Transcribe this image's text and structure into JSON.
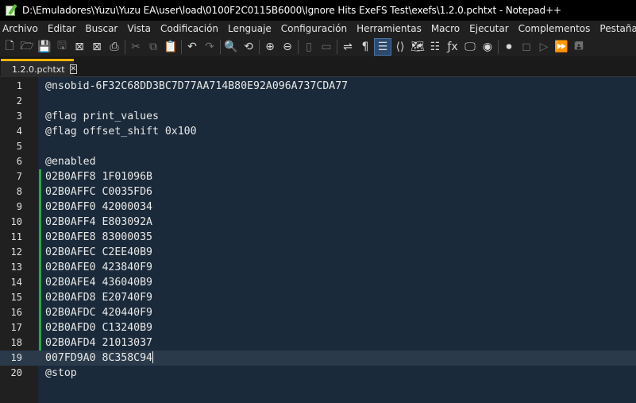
{
  "window": {
    "title": "D:\\Emuladores\\Yuzu\\Yuzu EA\\user\\load\\0100F2C0115B6000\\Ignore Hits ExeFS Test\\exefs\\1.2.0.pchtxt - Notepad++",
    "app_icon": "notepad-plus-plus-icon"
  },
  "menu": [
    "Archivo",
    "Editar",
    "Buscar",
    "Vista",
    "Codificación",
    "Lenguaje",
    "Configuración",
    "Herramientas",
    "Macro",
    "Ejecutar",
    "Complementos",
    "Pestañas",
    "?"
  ],
  "toolbar": [
    {
      "name": "new-file-icon",
      "glyph": "🗋",
      "dim": false
    },
    {
      "name": "open-file-icon",
      "glyph": "🗁",
      "dim": false
    },
    {
      "name": "save-icon",
      "glyph": "💾",
      "dim": true
    },
    {
      "name": "save-all-icon",
      "glyph": "🖫",
      "dim": true
    },
    {
      "name": "close-icon",
      "glyph": "⊠",
      "dim": false
    },
    {
      "name": "close-all-icon",
      "glyph": "⊠",
      "dim": false
    },
    {
      "name": "print-icon",
      "glyph": "⎙",
      "dim": false
    },
    {
      "sep": true
    },
    {
      "name": "cut-icon",
      "glyph": "✂",
      "dim": true
    },
    {
      "name": "copy-icon",
      "glyph": "⧉",
      "dim": true
    },
    {
      "name": "paste-icon",
      "glyph": "📋",
      "dim": false
    },
    {
      "sep": true
    },
    {
      "name": "undo-icon",
      "glyph": "↶",
      "dim": false
    },
    {
      "name": "redo-icon",
      "glyph": "↷",
      "dim": true
    },
    {
      "sep": true
    },
    {
      "name": "find-icon",
      "glyph": "🔍",
      "dim": false
    },
    {
      "name": "replace-icon",
      "glyph": "⟲",
      "dim": false
    },
    {
      "sep": true
    },
    {
      "name": "zoom-in-icon",
      "glyph": "⊕",
      "dim": false
    },
    {
      "name": "zoom-out-icon",
      "glyph": "⊖",
      "dim": false
    },
    {
      "sep": true
    },
    {
      "name": "sync-vertical-icon",
      "glyph": "▯",
      "dim": true
    },
    {
      "name": "sync-horizontal-icon",
      "glyph": "▭",
      "dim": true
    },
    {
      "sep": true
    },
    {
      "name": "word-wrap-icon",
      "glyph": "⇌",
      "dim": false
    },
    {
      "name": "show-all-chars-icon",
      "glyph": "¶",
      "dim": false
    },
    {
      "name": "indent-guide-icon",
      "glyph": "☰",
      "dim": false,
      "active": true
    },
    {
      "name": "xml-tag-icon",
      "glyph": "⟨⟩",
      "dim": false
    },
    {
      "name": "document-map-icon",
      "glyph": "🗺",
      "dim": false
    },
    {
      "name": "document-list-icon",
      "glyph": "☷",
      "dim": false
    },
    {
      "name": "function-list-icon",
      "glyph": "ƒx",
      "dim": false
    },
    {
      "name": "folder-workspace-icon",
      "glyph": "🖵",
      "dim": false
    },
    {
      "name": "monitoring-icon",
      "glyph": "◉",
      "dim": false
    },
    {
      "sep": true
    },
    {
      "name": "record-macro-icon",
      "glyph": "⏺",
      "dim": false
    },
    {
      "name": "stop-macro-icon",
      "glyph": "◻",
      "dim": true
    },
    {
      "name": "play-macro-icon",
      "glyph": "▷",
      "dim": true
    },
    {
      "name": "run-macro-multiple-icon",
      "glyph": "⏩",
      "dim": false
    },
    {
      "name": "save-macro-icon",
      "glyph": "🖪",
      "dim": true
    }
  ],
  "tab": {
    "label": "1.2.0.pchtxt",
    "close_glyph": "✕"
  },
  "editor": {
    "current_line": 19,
    "lines": [
      {
        "num": "1",
        "text": "@nsobid-6F32C68DD3BC7D77AA714B80E92A096A737CDA77"
      },
      {
        "num": "2",
        "text": ""
      },
      {
        "num": "3",
        "text": "@flag print_values"
      },
      {
        "num": "4",
        "text": "@flag offset_shift 0x100"
      },
      {
        "num": "5",
        "text": ""
      },
      {
        "num": "6",
        "text": "@enabled"
      },
      {
        "num": "7",
        "text": "02B0AFF8 1F01096B"
      },
      {
        "num": "8",
        "text": "02B0AFFC C0035FD6"
      },
      {
        "num": "9",
        "text": "02B0AFF0 42000034"
      },
      {
        "num": "10",
        "text": "02B0AFF4 E803092A"
      },
      {
        "num": "11",
        "text": "02B0AFE8 83000035"
      },
      {
        "num": "12",
        "text": "02B0AFEC C2EE40B9"
      },
      {
        "num": "13",
        "text": "02B0AFE0 423840F9"
      },
      {
        "num": "14",
        "text": "02B0AFE4 436040B9"
      },
      {
        "num": "15",
        "text": "02B0AFD8 E20740F9"
      },
      {
        "num": "16",
        "text": "02B0AFDC 420440F9"
      },
      {
        "num": "17",
        "text": "02B0AFD0 C13240B9"
      },
      {
        "num": "18",
        "text": "02B0AFD4 21013037"
      },
      {
        "num": "19",
        "text": "007FD9A0 8C358C94"
      },
      {
        "num": "20",
        "text": "@stop"
      }
    ]
  }
}
